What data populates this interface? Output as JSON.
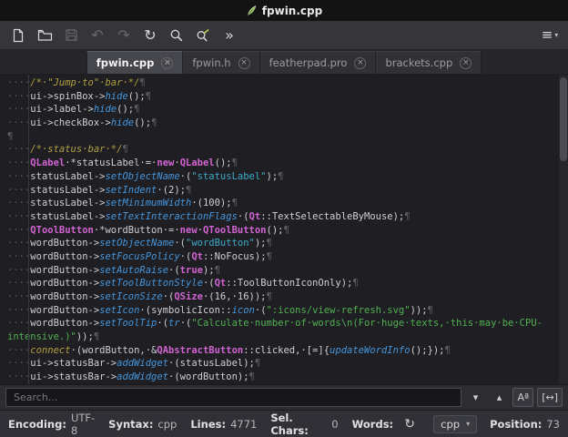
{
  "window": {
    "title": "fpwin.cpp"
  },
  "toolbar": {
    "buttons": [
      "new-file",
      "open-file",
      "save-file",
      "undo",
      "redo",
      "reload",
      "search",
      "find-replace",
      "overflow"
    ],
    "undo_glyph": "↶",
    "redo_glyph": "↷",
    "reload_glyph": "↻",
    "overflow_label": "»",
    "menu_bars_glyph": "≡",
    "menu_arrow_glyph": "▾"
  },
  "tabs": [
    {
      "label": "fpwin.cpp",
      "active": true
    },
    {
      "label": "fpwin.h",
      "active": false
    },
    {
      "label": "featherpad.pro",
      "active": false
    },
    {
      "label": "brackets.cpp",
      "active": false
    }
  ],
  "editor": {
    "lines": [
      [
        [
          "w",
          "····"
        ],
        [
          "c",
          "/*·\"Jump·to\"·bar·*/"
        ],
        [
          "w",
          "¶"
        ]
      ],
      [
        [
          "w",
          "····"
        ],
        [
          "t",
          "ui->spinBox->"
        ],
        [
          "f",
          "hide"
        ],
        [
          "t",
          "();"
        ],
        [
          "w",
          "¶"
        ]
      ],
      [
        [
          "w",
          "····"
        ],
        [
          "t",
          "ui->label->"
        ],
        [
          "f",
          "hide"
        ],
        [
          "t",
          "();"
        ],
        [
          "w",
          "¶"
        ]
      ],
      [
        [
          "w",
          "····"
        ],
        [
          "t",
          "ui->checkBox->"
        ],
        [
          "f",
          "hide"
        ],
        [
          "t",
          "();"
        ],
        [
          "w",
          "¶"
        ]
      ],
      [
        [
          "w",
          "¶"
        ]
      ],
      [
        [
          "w",
          "····"
        ],
        [
          "c",
          "/*·status·bar·*/"
        ],
        [
          "w",
          "¶"
        ]
      ],
      [
        [
          "w",
          "····"
        ],
        [
          "k",
          "QLabel"
        ],
        [
          "t",
          "·*statusLabel·=·"
        ],
        [
          "k",
          "new"
        ],
        [
          "t",
          "·"
        ],
        [
          "k",
          "QLabel"
        ],
        [
          "t",
          "();"
        ],
        [
          "w",
          "¶"
        ]
      ],
      [
        [
          "w",
          "····"
        ],
        [
          "t",
          "statusLabel->"
        ],
        [
          "f",
          "setObjectName"
        ],
        [
          "t",
          "·("
        ],
        [
          "s2",
          "\"statusLabel\""
        ],
        [
          "t",
          ");"
        ],
        [
          "w",
          "¶"
        ]
      ],
      [
        [
          "w",
          "····"
        ],
        [
          "t",
          "statusLabel->"
        ],
        [
          "f",
          "setIndent"
        ],
        [
          "t",
          "·(2);"
        ],
        [
          "w",
          "¶"
        ]
      ],
      [
        [
          "w",
          "····"
        ],
        [
          "t",
          "statusLabel->"
        ],
        [
          "f",
          "setMinimumWidth"
        ],
        [
          "t",
          "·(100);"
        ],
        [
          "w",
          "¶"
        ]
      ],
      [
        [
          "w",
          "····"
        ],
        [
          "t",
          "statusLabel->"
        ],
        [
          "f",
          "setTextInteractionFlags"
        ],
        [
          "t",
          "·("
        ],
        [
          "k",
          "Qt"
        ],
        [
          "t",
          "::TextSelectableByMouse);"
        ],
        [
          "w",
          "¶"
        ]
      ],
      [
        [
          "w",
          "····"
        ],
        [
          "k",
          "QToolButton"
        ],
        [
          "t",
          "·*wordButton·=·"
        ],
        [
          "k",
          "new"
        ],
        [
          "t",
          "·"
        ],
        [
          "k",
          "QToolButton"
        ],
        [
          "t",
          "();"
        ],
        [
          "w",
          "¶"
        ]
      ],
      [
        [
          "w",
          "····"
        ],
        [
          "t",
          "wordButton->"
        ],
        [
          "f",
          "setObjectName"
        ],
        [
          "t",
          "·("
        ],
        [
          "s2",
          "\"wordButton\""
        ],
        [
          "t",
          ");"
        ],
        [
          "w",
          "¶"
        ]
      ],
      [
        [
          "w",
          "····"
        ],
        [
          "t",
          "wordButton->"
        ],
        [
          "f",
          "setFocusPolicy"
        ],
        [
          "t",
          "·("
        ],
        [
          "k",
          "Qt"
        ],
        [
          "t",
          "::NoFocus);"
        ],
        [
          "w",
          "¶"
        ]
      ],
      [
        [
          "w",
          "····"
        ],
        [
          "t",
          "wordButton->"
        ],
        [
          "f",
          "setAutoRaise"
        ],
        [
          "t",
          "·("
        ],
        [
          "k",
          "true"
        ],
        [
          "t",
          ");"
        ],
        [
          "w",
          "¶"
        ]
      ],
      [
        [
          "w",
          "····"
        ],
        [
          "t",
          "wordButton->"
        ],
        [
          "f",
          "setToolButtonStyle"
        ],
        [
          "t",
          "·("
        ],
        [
          "k",
          "Qt"
        ],
        [
          "t",
          "::ToolButtonIconOnly);"
        ],
        [
          "w",
          "¶"
        ]
      ],
      [
        [
          "w",
          "····"
        ],
        [
          "t",
          "wordButton->"
        ],
        [
          "f",
          "setIconSize"
        ],
        [
          "t",
          "·("
        ],
        [
          "k",
          "QSize"
        ],
        [
          "t",
          "·(16,·16));"
        ],
        [
          "w",
          "¶"
        ]
      ],
      [
        [
          "w",
          "····"
        ],
        [
          "t",
          "wordButton->"
        ],
        [
          "f",
          "setIcon"
        ],
        [
          "t",
          "·(symbolicIcon::"
        ],
        [
          "f",
          "icon"
        ],
        [
          "t",
          "·("
        ],
        [
          "s",
          "\":icons/view-refresh.svg\""
        ],
        [
          "t",
          "));"
        ],
        [
          "w",
          "¶"
        ]
      ],
      [
        [
          "w",
          "····"
        ],
        [
          "t",
          "wordButton->"
        ],
        [
          "f",
          "setToolTip"
        ],
        [
          "t",
          "·("
        ],
        [
          "f",
          "tr"
        ],
        [
          "t",
          "·("
        ],
        [
          "s",
          "\"Calculate·number·of·words\\n(For·huge·texts,·this·may·be·CPU-"
        ]
      ],
      [
        [
          "s",
          "intensive.)\""
        ],
        [
          "t",
          "));"
        ],
        [
          "w",
          "¶"
        ]
      ],
      [
        [
          "w",
          "····"
        ],
        [
          "q",
          "connect"
        ],
        [
          "t",
          "·(wordButton,·&"
        ],
        [
          "k",
          "QAbstractButton"
        ],
        [
          "t",
          "::clicked,·[=]{"
        ],
        [
          "f",
          "updateWordInfo"
        ],
        [
          "t",
          "();});"
        ],
        [
          "w",
          "¶"
        ]
      ],
      [
        [
          "w",
          "····"
        ],
        [
          "t",
          "ui->statusBar->"
        ],
        [
          "f",
          "addWidget"
        ],
        [
          "t",
          "·(statusLabel);"
        ],
        [
          "w",
          "¶"
        ]
      ],
      [
        [
          "w",
          "····"
        ],
        [
          "t",
          "ui->statusBar->"
        ],
        [
          "f",
          "addWidget"
        ],
        [
          "t",
          "·(wordButton);"
        ],
        [
          "w",
          "¶"
        ]
      ]
    ]
  },
  "search": {
    "placeholder": "Search...",
    "next_icon": "▾",
    "prev_icon": "▴",
    "match_case_icon": "Aª",
    "whole_word_icon": "[↔]"
  },
  "statusbar": {
    "items": [
      {
        "label": "Encoding:",
        "value": "UTF-8"
      },
      {
        "label": "Syntax:",
        "value": "cpp"
      },
      {
        "label": "Lines:",
        "value": "4771"
      },
      {
        "label": "Sel. Chars:",
        "value": "0"
      },
      {
        "label": "Words:",
        "value": ""
      }
    ],
    "refresh_glyph": "↻",
    "syntax_combo": "cpp",
    "combo_arrow": "▾",
    "position_label": "Position:",
    "position_value": "73"
  },
  "colors": {
    "editor_bg": "#1e1e23",
    "keyword": "#d264d2",
    "function": "#4596dc",
    "comment": "#b0a041",
    "string_green": "#52b152",
    "string_cyan": "#3fa9c9",
    "plain_text": "#cfd0d3"
  }
}
